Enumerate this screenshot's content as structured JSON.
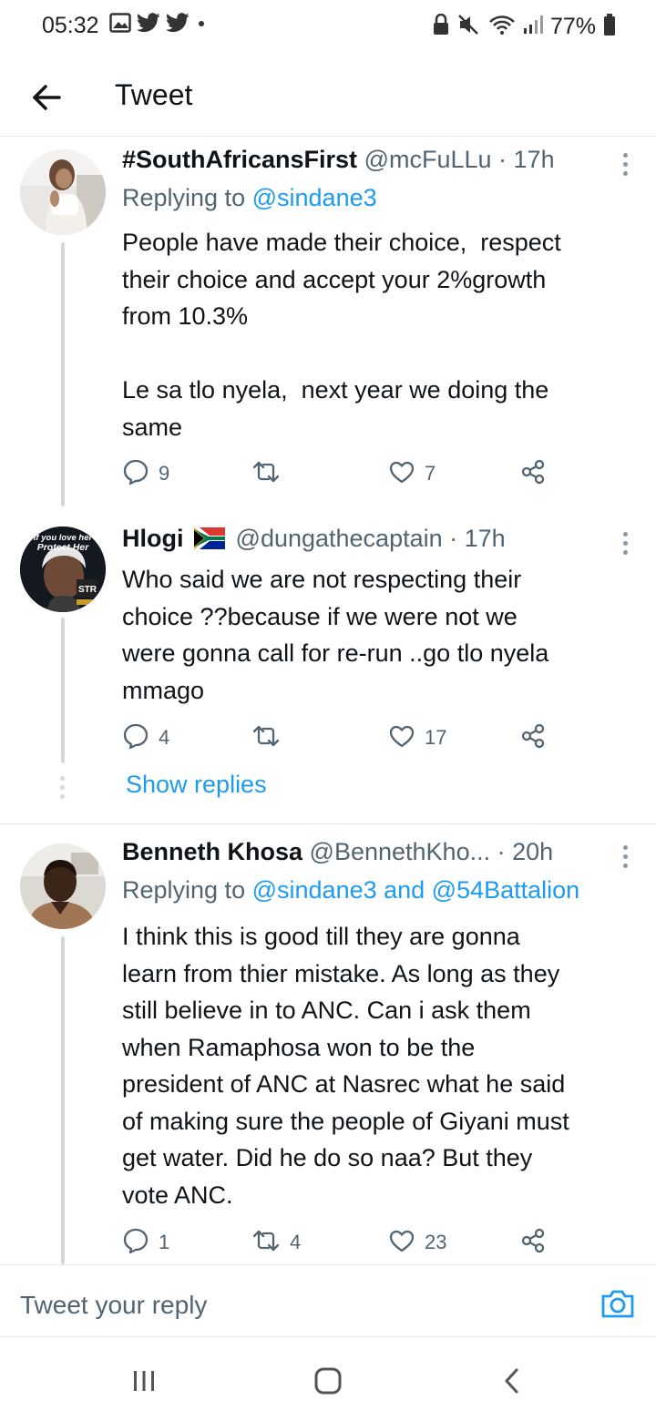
{
  "status_bar": {
    "time": "05:32",
    "battery": "77%"
  },
  "header": {
    "title": "Tweet"
  },
  "tweets": [
    {
      "name": "#SouthAfricansFirst",
      "handle": "@mcFuLLu",
      "time": "· 17h",
      "replying_prefix": "Replying to",
      "replying_to": "@sindane3",
      "body": "People have made their choice,  respect\ntheir choice and accept your 2%growth\nfrom 10.3%\n\nLe sa tlo nyela,  next year we doing the\nsame",
      "reply_count": "9",
      "retweet_count": "",
      "like_count": "7"
    },
    {
      "name": "Hlogi",
      "handle": "@dungathecaptain",
      "time": "· 17h",
      "avatar_text_top": "If you love her",
      "avatar_text_bottom": "Protect Her",
      "avatar_logo": "STR",
      "body": "Who said we are not respecting their\nchoice ??because if we were not we\nwere gonna call for re-run ..go tlo nyela\nmmago",
      "reply_count": "4",
      "retweet_count": "",
      "like_count": "17",
      "show_replies": "Show replies"
    },
    {
      "name": "Benneth Khosa",
      "handle": "@BennethKho...",
      "time": "· 20h",
      "replying_prefix": "Replying to",
      "replying_to": "@sindane3 and @54Battalion",
      "body": "I think this is good till they are gonna\nlearn from thier mistake. As long as they\nstill believe in to ANC. Can i ask them\nwhen Ramaphosa won to be the\npresident of ANC at Nasrec what he said\nof making sure the people of Giyani must\nget water. Did he do so naa? But they\nvote ANC.",
      "reply_count": "1",
      "retweet_count": "4",
      "like_count": "23"
    }
  ],
  "reply_bar": {
    "placeholder": "Tweet your reply"
  },
  "colors": {
    "accent": "#1d9bf0",
    "text": "#0f1419",
    "secondary": "#536471",
    "thread_line": "#cfd9de"
  }
}
